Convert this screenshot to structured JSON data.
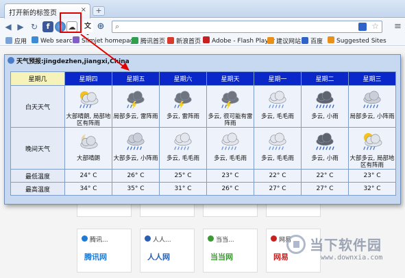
{
  "browser": {
    "tab_title": "打开新的标签页",
    "tab_close": "×",
    "new_tab": "+"
  },
  "bookmarks": [
    {
      "label": "应用",
      "color": "#7aa2d6"
    },
    {
      "label": "Web search",
      "color": "#3b8bd6"
    },
    {
      "label": "Slimjet homepage",
      "color": "#7f5fc4"
    },
    {
      "label": "腾讯首页",
      "color": "#2f9e4d"
    },
    {
      "label": "新浪首页",
      "color": "#d93a2b"
    },
    {
      "label": "Adobe - Flash Player",
      "color": "#c82020"
    },
    {
      "label": "建议网站",
      "color": "#e89018"
    },
    {
      "label": "百度",
      "color": "#2f63c9"
    },
    {
      "label": "Suggested Sites",
      "color": "#e89018"
    }
  ],
  "popup": {
    "title": "天气预报:jingdezhen,jiangxi,China",
    "header_first": "星期几",
    "row_day_label": "白天天气",
    "row_night_label": "晚间天气",
    "row_low_label": "最低温度",
    "row_high_label": "最高温度",
    "days": [
      {
        "name": "星期四",
        "day_cond": "大部晴朗, 局部地区有阵雨",
        "day_icon": "partly-sunny-shower-icon",
        "night_cond": "大部晴朗",
        "night_icon": "cloudy-moon-icon",
        "low": "24° C",
        "high": "34° C"
      },
      {
        "name": "星期五",
        "day_cond": "局部多云, 雷阵雨",
        "day_icon": "thunderstorm-icon",
        "night_cond": "大部多云, 小阵雨",
        "night_icon": "showers-icon",
        "low": "26° C",
        "high": "35° C"
      },
      {
        "name": "星期六",
        "day_cond": "多云, 雷阵雨",
        "day_icon": "thunderstorm-icon",
        "night_cond": "多云, 毛毛雨",
        "night_icon": "drizzle-icon",
        "low": "25° C",
        "high": "31° C"
      },
      {
        "name": "星期天",
        "day_cond": "多云, 很可能有雷阵雨",
        "day_icon": "thunderstorm-icon",
        "night_cond": "多云, 毛毛雨",
        "night_icon": "drizzle-icon",
        "low": "23° C",
        "high": "26° C"
      },
      {
        "name": "星期一",
        "day_cond": "多云, 毛毛雨",
        "day_icon": "drizzle-icon",
        "night_cond": "多云, 毛毛雨",
        "night_icon": "drizzle-icon",
        "low": "22° C",
        "high": "27° C"
      },
      {
        "name": "星期二",
        "day_cond": "多云, 小雨",
        "day_icon": "rain-icon",
        "night_cond": "多云, 小雨",
        "night_icon": "rain-icon",
        "low": "22° C",
        "high": "27° C"
      },
      {
        "name": "星期三",
        "day_cond": "局部多云, 小阵雨",
        "day_icon": "showers-icon",
        "night_cond": "大部多云, 局部地区有阵雨",
        "night_icon": "partly-sunny-shower-icon",
        "low": "23° C",
        "high": "32° C"
      }
    ]
  },
  "tiles": [
    {
      "label": "腾讯...",
      "logo": "腾讯网",
      "color": "#1f7ad6"
    },
    {
      "label": "人人...",
      "logo": "人人网",
      "color": "#2a5fb4"
    },
    {
      "label": "当当...",
      "logo": "当当网",
      "color": "#3c9a32"
    },
    {
      "label": "网易",
      "logo": "网易",
      "color": "#c8201f"
    }
  ],
  "watermark": {
    "text": "当下软件园",
    "url": "www.downxia.com"
  }
}
